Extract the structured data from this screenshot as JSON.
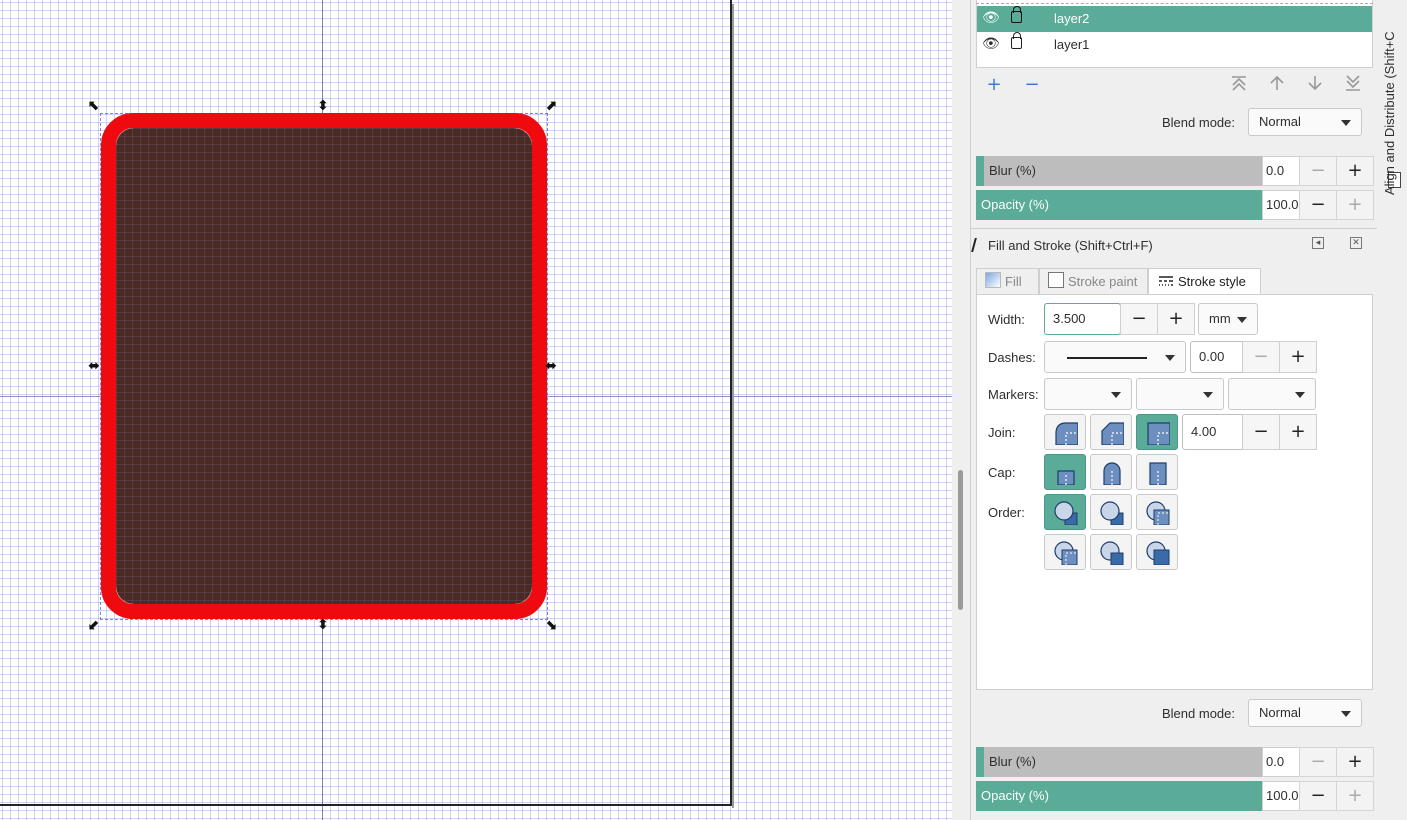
{
  "layers": {
    "items": [
      {
        "name": "layer2",
        "selected": true
      },
      {
        "name": "layer1",
        "selected": false
      }
    ],
    "toolbar_icons": [
      "add-icon",
      "remove-icon",
      "raise-to-top-icon",
      "raise-icon",
      "lower-icon",
      "lower-to-bottom-icon"
    ],
    "blend_mode_label": "Blend mode:",
    "blend_mode_value": "Normal",
    "blur_label": "Blur (%)",
    "blur_value": "0.0",
    "opacity_label": "Opacity (%)",
    "opacity_value": "100.0"
  },
  "side_tab": {
    "label": "Align and Distribute (Shift+C"
  },
  "fill_stroke": {
    "title": "Fill and Stroke (Shift+Ctrl+F)",
    "tabs": [
      {
        "label": "Fill",
        "active": false
      },
      {
        "label": "Stroke paint",
        "active": false
      },
      {
        "label": "Stroke style",
        "active": true
      }
    ],
    "width_label": "Width:",
    "width_value": "3.500",
    "width_unit": "mm",
    "dashes_label": "Dashes:",
    "dashes_value": "0.00",
    "markers_label": "Markers:",
    "join_label": "Join:",
    "join_value": "4.00",
    "cap_label": "Cap:",
    "order_label": "Order:",
    "blend_mode_label": "Blend mode:",
    "blend_mode_value": "Normal",
    "blur_label": "Blur (%)",
    "blur_value": "0.0",
    "opacity_label": "Opacity (%)",
    "opacity_value": "100.0"
  },
  "buttons": {
    "plus": "+",
    "minus": "−",
    "add": "+",
    "remove": "−"
  },
  "colors": {
    "accent": "#5aab98",
    "shape_fill": "#4a2a22",
    "shape_stroke": "#ee0a0f",
    "grid": "#5f69eb"
  }
}
